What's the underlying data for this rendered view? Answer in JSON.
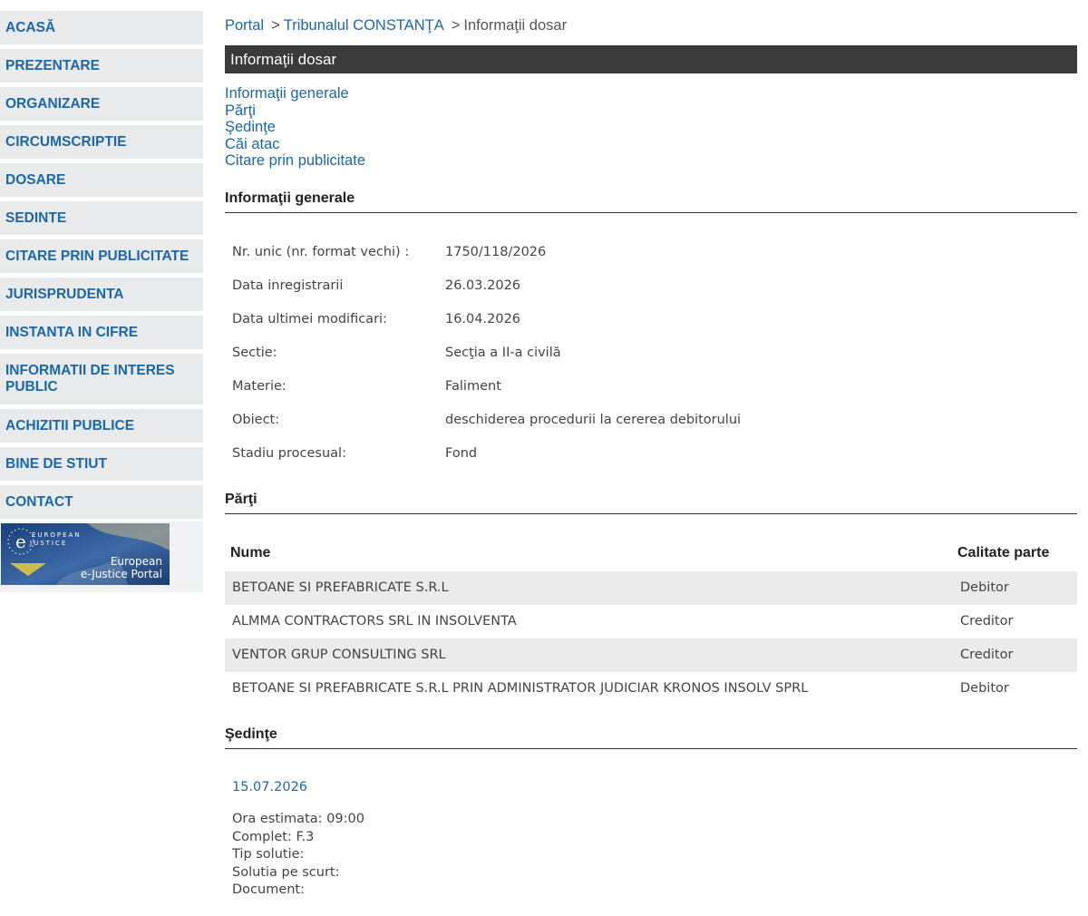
{
  "sidebar": {
    "items": [
      {
        "label": "ACASĂ"
      },
      {
        "label": "PREZENTARE"
      },
      {
        "label": "ORGANIZARE"
      },
      {
        "label": "CIRCUMSCRIPTIE"
      },
      {
        "label": "DOSARE"
      },
      {
        "label": "SEDINTE"
      },
      {
        "label": "CITARE PRIN PUBLICITATE"
      },
      {
        "label": "JURISPRUDENTA"
      },
      {
        "label": "INSTANTA IN CIFRE"
      },
      {
        "label_line1": "INFORMATII DE INTERES",
        "label_line2": "PUBLIC"
      },
      {
        "label": "ACHIZITII PUBLICE"
      },
      {
        "label": "BINE DE STIUT"
      },
      {
        "label": "CONTACT"
      }
    ],
    "banner": {
      "line1": "EUROPEAN",
      "line2": "JUSTICE",
      "line3": "European",
      "line4": "e-Justice Portal"
    }
  },
  "breadcrumb": {
    "portal": "Portal",
    "court": "Tribunalul CONSTANŢA",
    "current": "Informaţii dosar",
    "separator": ">"
  },
  "title": "Informaţii dosar",
  "toc": [
    "Informaţii generale",
    "Părţi",
    "Şedinţe",
    "Căi atac",
    "Citare prin publicitate"
  ],
  "sections": {
    "general": "Informaţii generale",
    "parti": "Părţi",
    "sedinte": "Şedinţe"
  },
  "general_info": [
    {
      "label": "Nr. unic (nr. format vechi) :",
      "value": "1750/118/2026"
    },
    {
      "label": "Data inregistrarii",
      "value": "26.03.2026"
    },
    {
      "label": "Data ultimei modificari:",
      "value": "16.04.2026"
    },
    {
      "label": "Sectie:",
      "value": "Secţia a II-a civilă"
    },
    {
      "label": "Materie:",
      "value": "Faliment"
    },
    {
      "label": "Obiect:",
      "value": "deschiderea procedurii la cererea debitorului"
    },
    {
      "label": "Stadiu procesual:",
      "value": "Fond"
    }
  ],
  "parti_table": {
    "headers": {
      "name": "Nume",
      "role": "Calitate parte"
    },
    "rows": [
      {
        "name": "BETOANE SI PREFABRICATE S.R.L",
        "role": "Debitor"
      },
      {
        "name": "ALMMA CONTRACTORS SRL IN INSOLVENTA",
        "role": "Creditor"
      },
      {
        "name": "VENTOR GRUP CONSULTING SRL",
        "role": "Creditor"
      },
      {
        "name": "BETOANE SI PREFABRICATE S.R.L PRIN ADMINISTRATOR JUDICIAR KRONOS INSOLV SPRL",
        "role": "Debitor"
      }
    ]
  },
  "sedinte": {
    "date": "15.07.2026",
    "ora": "Ora estimata: 09:00",
    "complet": "Complet: F.3",
    "tip_solutie": "Tip solutie:",
    "solutia": "Solutia pe scurt:",
    "document": "Document:"
  },
  "colors": {
    "link": "#1b67a8",
    "titlebar": "#3a3a3a",
    "sidebar_bg": "#e8eaec",
    "row_alt": "#ebebeb"
  }
}
